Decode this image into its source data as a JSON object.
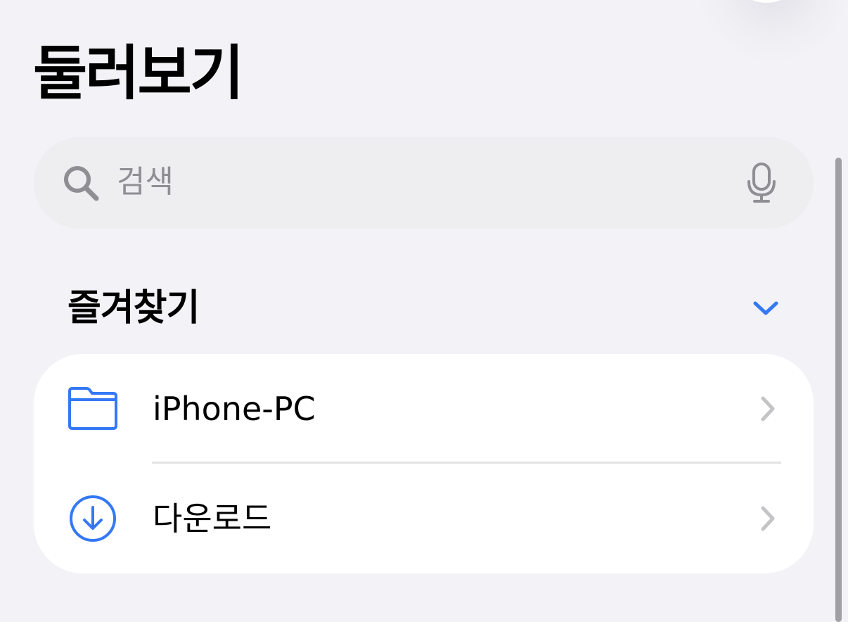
{
  "header": {
    "title": "둘러보기"
  },
  "search": {
    "placeholder": "검색",
    "icon": "search-icon",
    "mic_icon": "microphone-icon"
  },
  "favorites": {
    "title": "즐겨찾기",
    "expanded": true,
    "toggle_icon": "chevron-down-icon",
    "items": [
      {
        "label": "iPhone-PC",
        "icon": "folder-icon"
      },
      {
        "label": "다운로드",
        "icon": "download-circle-icon"
      }
    ]
  },
  "colors": {
    "accent": "#3478f6",
    "background": "#f2f2f7",
    "card": "#ffffff",
    "placeholder": "#8e8e93",
    "chevron": "#c4c4c7"
  }
}
